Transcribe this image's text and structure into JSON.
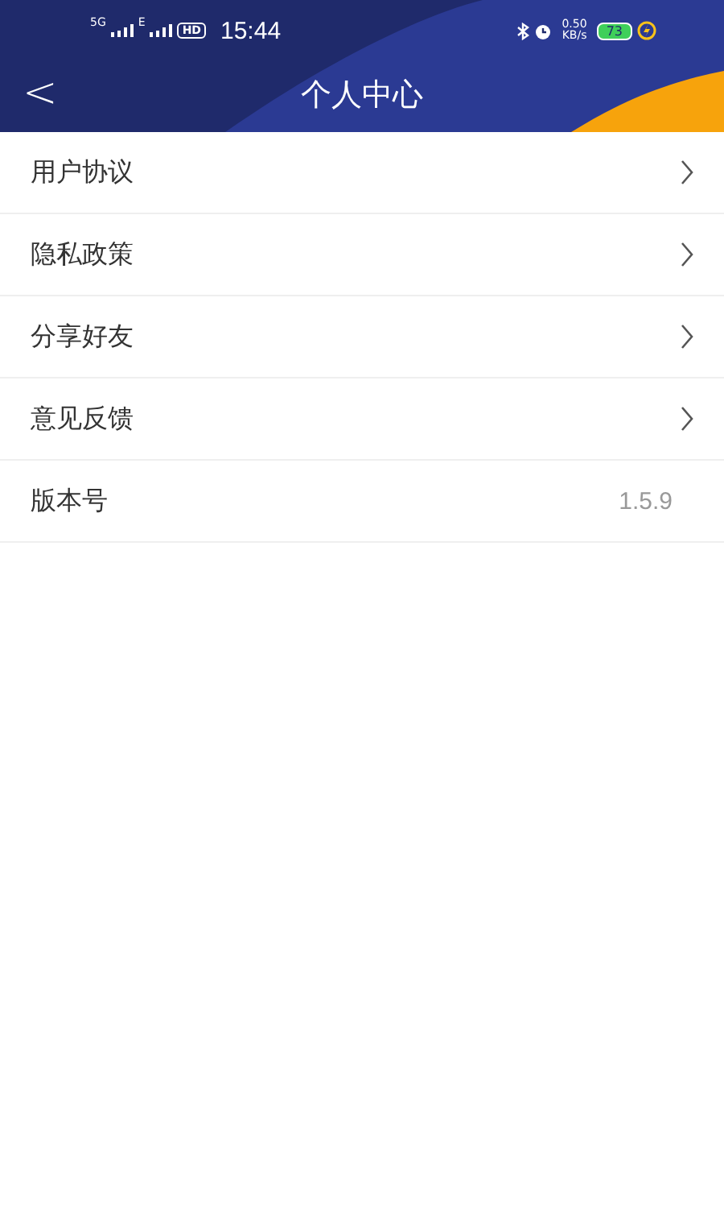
{
  "status_bar": {
    "network_1": "5G",
    "network_2": "E",
    "hd": "HD",
    "time": "15:44",
    "speed_value": "0.50",
    "speed_unit": "KB/s",
    "battery": "73"
  },
  "header": {
    "back": "<",
    "title": "个人中心"
  },
  "menu": [
    {
      "kind": "link",
      "label": "用户协议"
    },
    {
      "kind": "link",
      "label": "隐私政策"
    },
    {
      "kind": "link",
      "label": "分享好友"
    },
    {
      "kind": "link",
      "label": "意见反馈"
    },
    {
      "kind": "value",
      "label": "版本号",
      "value": "1.5.9"
    }
  ]
}
